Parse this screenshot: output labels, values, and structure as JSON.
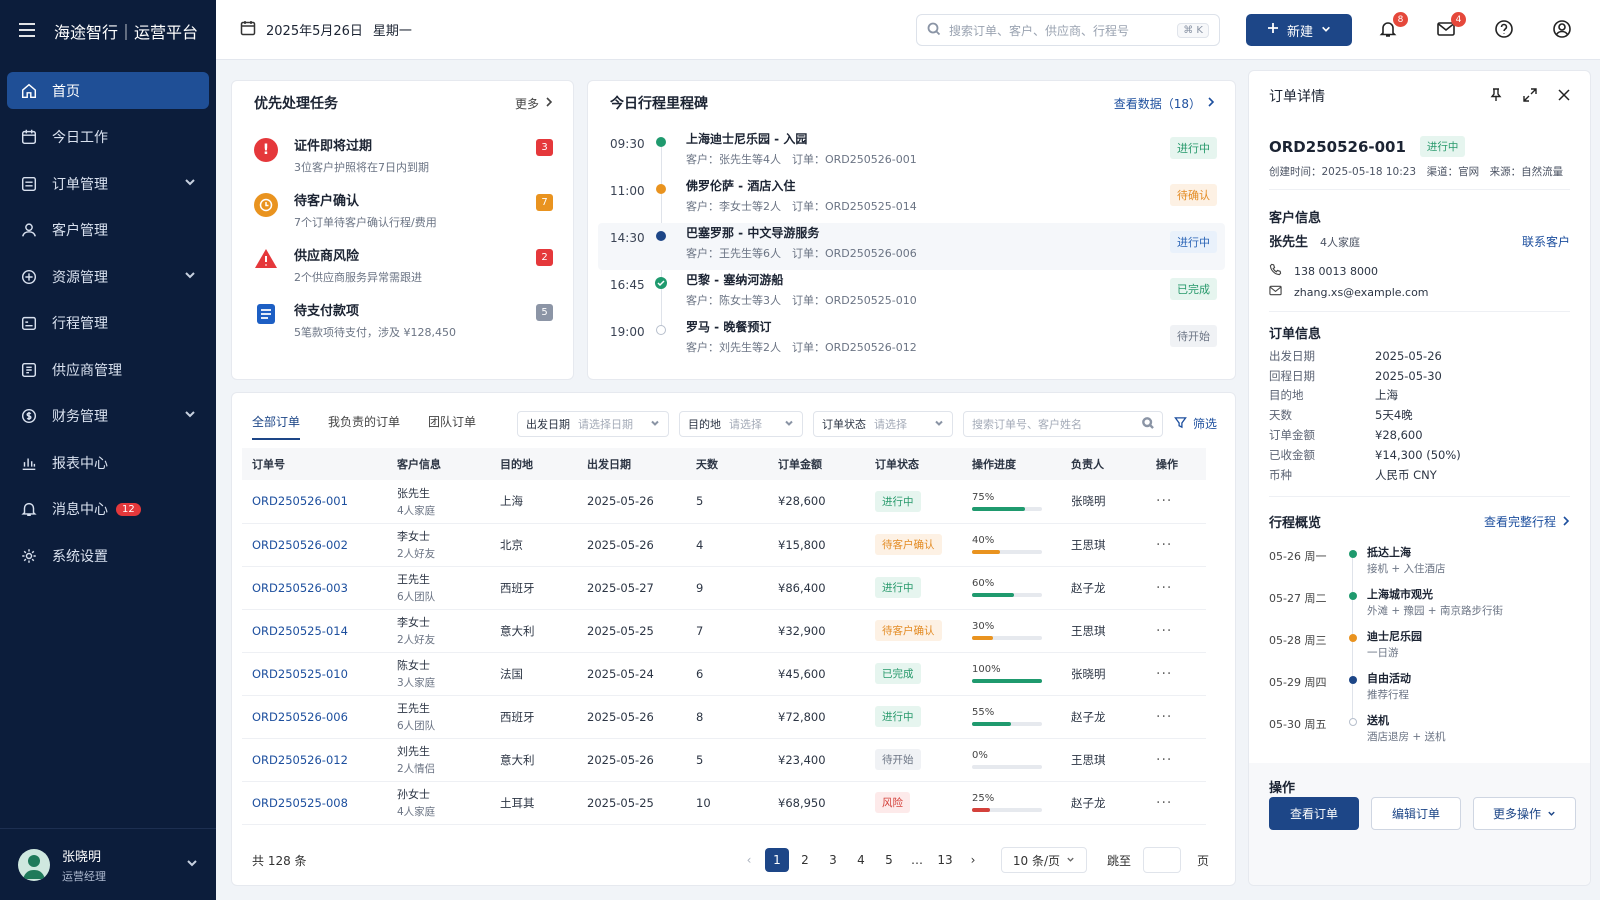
{
  "app": {
    "title": "海途智行｜运营平台"
  },
  "header": {
    "date": "2025年5月26日",
    "weekday": "星期一",
    "search_placeholder": "搜索订单、客户、供应商、行程号",
    "search_shortcut": "⌘ K",
    "new_button": "新建",
    "notifications_count": "8",
    "mail_count": "4"
  },
  "sidebar": {
    "items": [
      {
        "label": "首页",
        "icon": "home-icon"
      },
      {
        "label": "今日工作",
        "icon": "calendar-icon"
      },
      {
        "label": "订单管理",
        "icon": "orders-icon"
      },
      {
        "label": "客户管理",
        "icon": "user-icon"
      },
      {
        "label": "资源管理",
        "icon": "resource-icon"
      },
      {
        "label": "行程管理",
        "icon": "itinerary-icon"
      },
      {
        "label": "供应商管理",
        "icon": "supplier-icon"
      },
      {
        "label": "财务管理",
        "icon": "finance-icon"
      },
      {
        "label": "报表中心",
        "icon": "chart-icon"
      },
      {
        "label": "消息中心",
        "icon": "bell-icon",
        "badge": "12"
      },
      {
        "label": "系统设置",
        "icon": "gear-icon"
      }
    ],
    "user": {
      "name": "张晓明",
      "role": "运营经理"
    }
  },
  "tasks": {
    "title": "优先处理任务",
    "more": "更多",
    "items": [
      {
        "title": "证件即将过期",
        "sub": "3位客户护照将在7日内到期",
        "count": "3",
        "color": "#e5383b"
      },
      {
        "title": "待客户确认",
        "sub": "7个订单待客户确认行程/费用",
        "count": "7",
        "color": "#e9931f"
      },
      {
        "title": "供应商风险",
        "sub": "2个供应商服务异常需跟进",
        "count": "2",
        "color": "#e5383b"
      },
      {
        "title": "待支付款项",
        "sub": "5笔款项待支付，涉及 ¥128,450",
        "count": "5",
        "color": "#1d5fc4"
      }
    ]
  },
  "milestones": {
    "title": "今日行程里程碑",
    "link": "查看数据（18）",
    "items": [
      {
        "time": "09:30",
        "title": "上海迪士尼乐园 - 入园",
        "sub": "客户：张先生等4人　订单：ORD250526-001",
        "status": "进行中",
        "dot": "#1f9a6e"
      },
      {
        "time": "11:00",
        "title": "佛罗伦萨 - 酒店入住",
        "sub": "客户：李女士等2人　订单：ORD250525-014",
        "status": "待确认",
        "dot": "#e9931f"
      },
      {
        "time": "14:30",
        "title": "巴塞罗那 - 中文导游服务",
        "sub": "客户：王先生等6人　订单：ORD250526-006",
        "status": "进行中",
        "dot": "#1d4687"
      },
      {
        "time": "16:45",
        "title": "巴黎 - 塞纳河游船",
        "sub": "客户：陈女士等3人　订单：ORD250525-010",
        "status": "已完成",
        "dot": "#1f9a6e"
      },
      {
        "time": "19:00",
        "title": "罗马 - 晚餐预订",
        "sub": "客户：刘先生等2人　订单：ORD250526-012",
        "status": "待开始",
        "dot": "#ffffff"
      }
    ]
  },
  "orders": {
    "tabs": [
      "全部订单",
      "我负责的订单",
      "团队订单"
    ],
    "filters": {
      "date_label": "出发日期",
      "date_ph": "请选择日期",
      "dest_label": "目的地",
      "dest_ph": "请选择",
      "status_label": "订单状态",
      "status_ph": "请选择",
      "search_ph": "搜索订单号、客户姓名",
      "filter_btn": "筛选"
    },
    "columns": [
      "订单号",
      "客户信息",
      "目的地",
      "出发日期",
      "天数",
      "订单金额",
      "订单状态",
      "操作进度",
      "负责人",
      "操作"
    ],
    "rows": [
      {
        "id": "ORD250526-001",
        "c1": "张先生",
        "c2": "4人家庭",
        "dest": "上海",
        "date": "2025-05-26",
        "days": "5",
        "amount": "¥28,600",
        "status": "进行中",
        "pct": "75%",
        "progress": 0.75,
        "owner": "张晓明"
      },
      {
        "id": "ORD250526-002",
        "c1": "李女士",
        "c2": "2人好友",
        "dest": "北京",
        "date": "2025-05-26",
        "days": "4",
        "amount": "¥15,800",
        "status": "待客户确认",
        "pct": "40%",
        "progress": 0.4,
        "owner": "王思琪"
      },
      {
        "id": "ORD250526-003",
        "c1": "王先生",
        "c2": "6人团队",
        "dest": "西班牙",
        "date": "2025-05-27",
        "days": "9",
        "amount": "¥86,400",
        "status": "进行中",
        "pct": "60%",
        "progress": 0.6,
        "owner": "赵子龙"
      },
      {
        "id": "ORD250525-014",
        "c1": "李女士",
        "c2": "2人好友",
        "dest": "意大利",
        "date": "2025-05-25",
        "days": "7",
        "amount": "¥32,900",
        "status": "待客户确认",
        "pct": "30%",
        "progress": 0.3,
        "owner": "王思琪"
      },
      {
        "id": "ORD250525-010",
        "c1": "陈女士",
        "c2": "3人家庭",
        "dest": "法国",
        "date": "2025-05-24",
        "days": "6",
        "amount": "¥45,600",
        "status": "已完成",
        "pct": "100%",
        "progress": 1.0,
        "owner": "张晓明"
      },
      {
        "id": "ORD250526-006",
        "c1": "王先生",
        "c2": "6人团队",
        "dest": "西班牙",
        "date": "2025-05-26",
        "days": "8",
        "amount": "¥72,800",
        "status": "进行中",
        "pct": "55%",
        "progress": 0.55,
        "owner": "赵子龙"
      },
      {
        "id": "ORD250526-012",
        "c1": "刘先生",
        "c2": "2人情侣",
        "dest": "意大利",
        "date": "2025-05-26",
        "days": "5",
        "amount": "¥23,400",
        "status": "待开始",
        "pct": "0%",
        "progress": 0.0,
        "owner": "王思琪"
      },
      {
        "id": "ORD250525-008",
        "c1": "孙女士",
        "c2": "4人家庭",
        "dest": "土耳其",
        "date": "2025-05-25",
        "days": "10",
        "amount": "¥68,950",
        "status": "风险",
        "pct": "25%",
        "progress": 0.25,
        "owner": "赵子龙"
      }
    ],
    "pager": {
      "total": "共 128 条",
      "pages": [
        "1",
        "2",
        "3",
        "4",
        "5",
        "…",
        "13"
      ],
      "size": "10 条/页",
      "jump": "跳至",
      "page_unit": "页"
    }
  },
  "detail": {
    "title": "订单详情",
    "order_id": "ORD250526-001",
    "status": "进行中",
    "meta": "创建时间：2025-05-18 10:23　渠道：官网　来源：自然流量",
    "customer_title": "客户信息",
    "customer_name": "张先生",
    "customer_group": "4人家庭",
    "contact_link": "联系客户",
    "phone": "138 0013 8000",
    "email": "zhang.xs@example.com",
    "order_info_title": "订单信息",
    "order_info": [
      {
        "k": "出发日期",
        "v": "2025-05-26"
      },
      {
        "k": "回程日期",
        "v": "2025-05-30"
      },
      {
        "k": "目的地",
        "v": "上海"
      },
      {
        "k": "天数",
        "v": "5天4晚"
      },
      {
        "k": "订单金额",
        "v": "¥28,600"
      },
      {
        "k": "已收金额",
        "v": "¥14,300 (50%)"
      },
      {
        "k": "币种",
        "v": "人民币 CNY"
      }
    ],
    "itinerary_title": "行程概览",
    "itinerary_link": "查看完整行程",
    "itinerary": [
      {
        "date": "05-26 周一",
        "title": "抵达上海",
        "sub": "接机 + 入住酒店",
        "dot": "#1f9a6e"
      },
      {
        "date": "05-27 周二",
        "title": "上海城市观光",
        "sub": "外滩 + 豫园 + 南京路步行街",
        "dot": "#1f9a6e"
      },
      {
        "date": "05-28 周三",
        "title": "迪士尼乐园",
        "sub": "一日游",
        "dot": "#e9931f"
      },
      {
        "date": "05-29 周四",
        "title": "自由活动",
        "sub": "推荐行程",
        "dot": "#1d4687"
      },
      {
        "date": "05-30 周五",
        "title": "送机",
        "sub": "酒店退房 + 送机",
        "dot": "#ffffff"
      }
    ],
    "actions_title": "操作",
    "actions": [
      "查看订单",
      "编辑订单",
      "更多操作"
    ]
  }
}
